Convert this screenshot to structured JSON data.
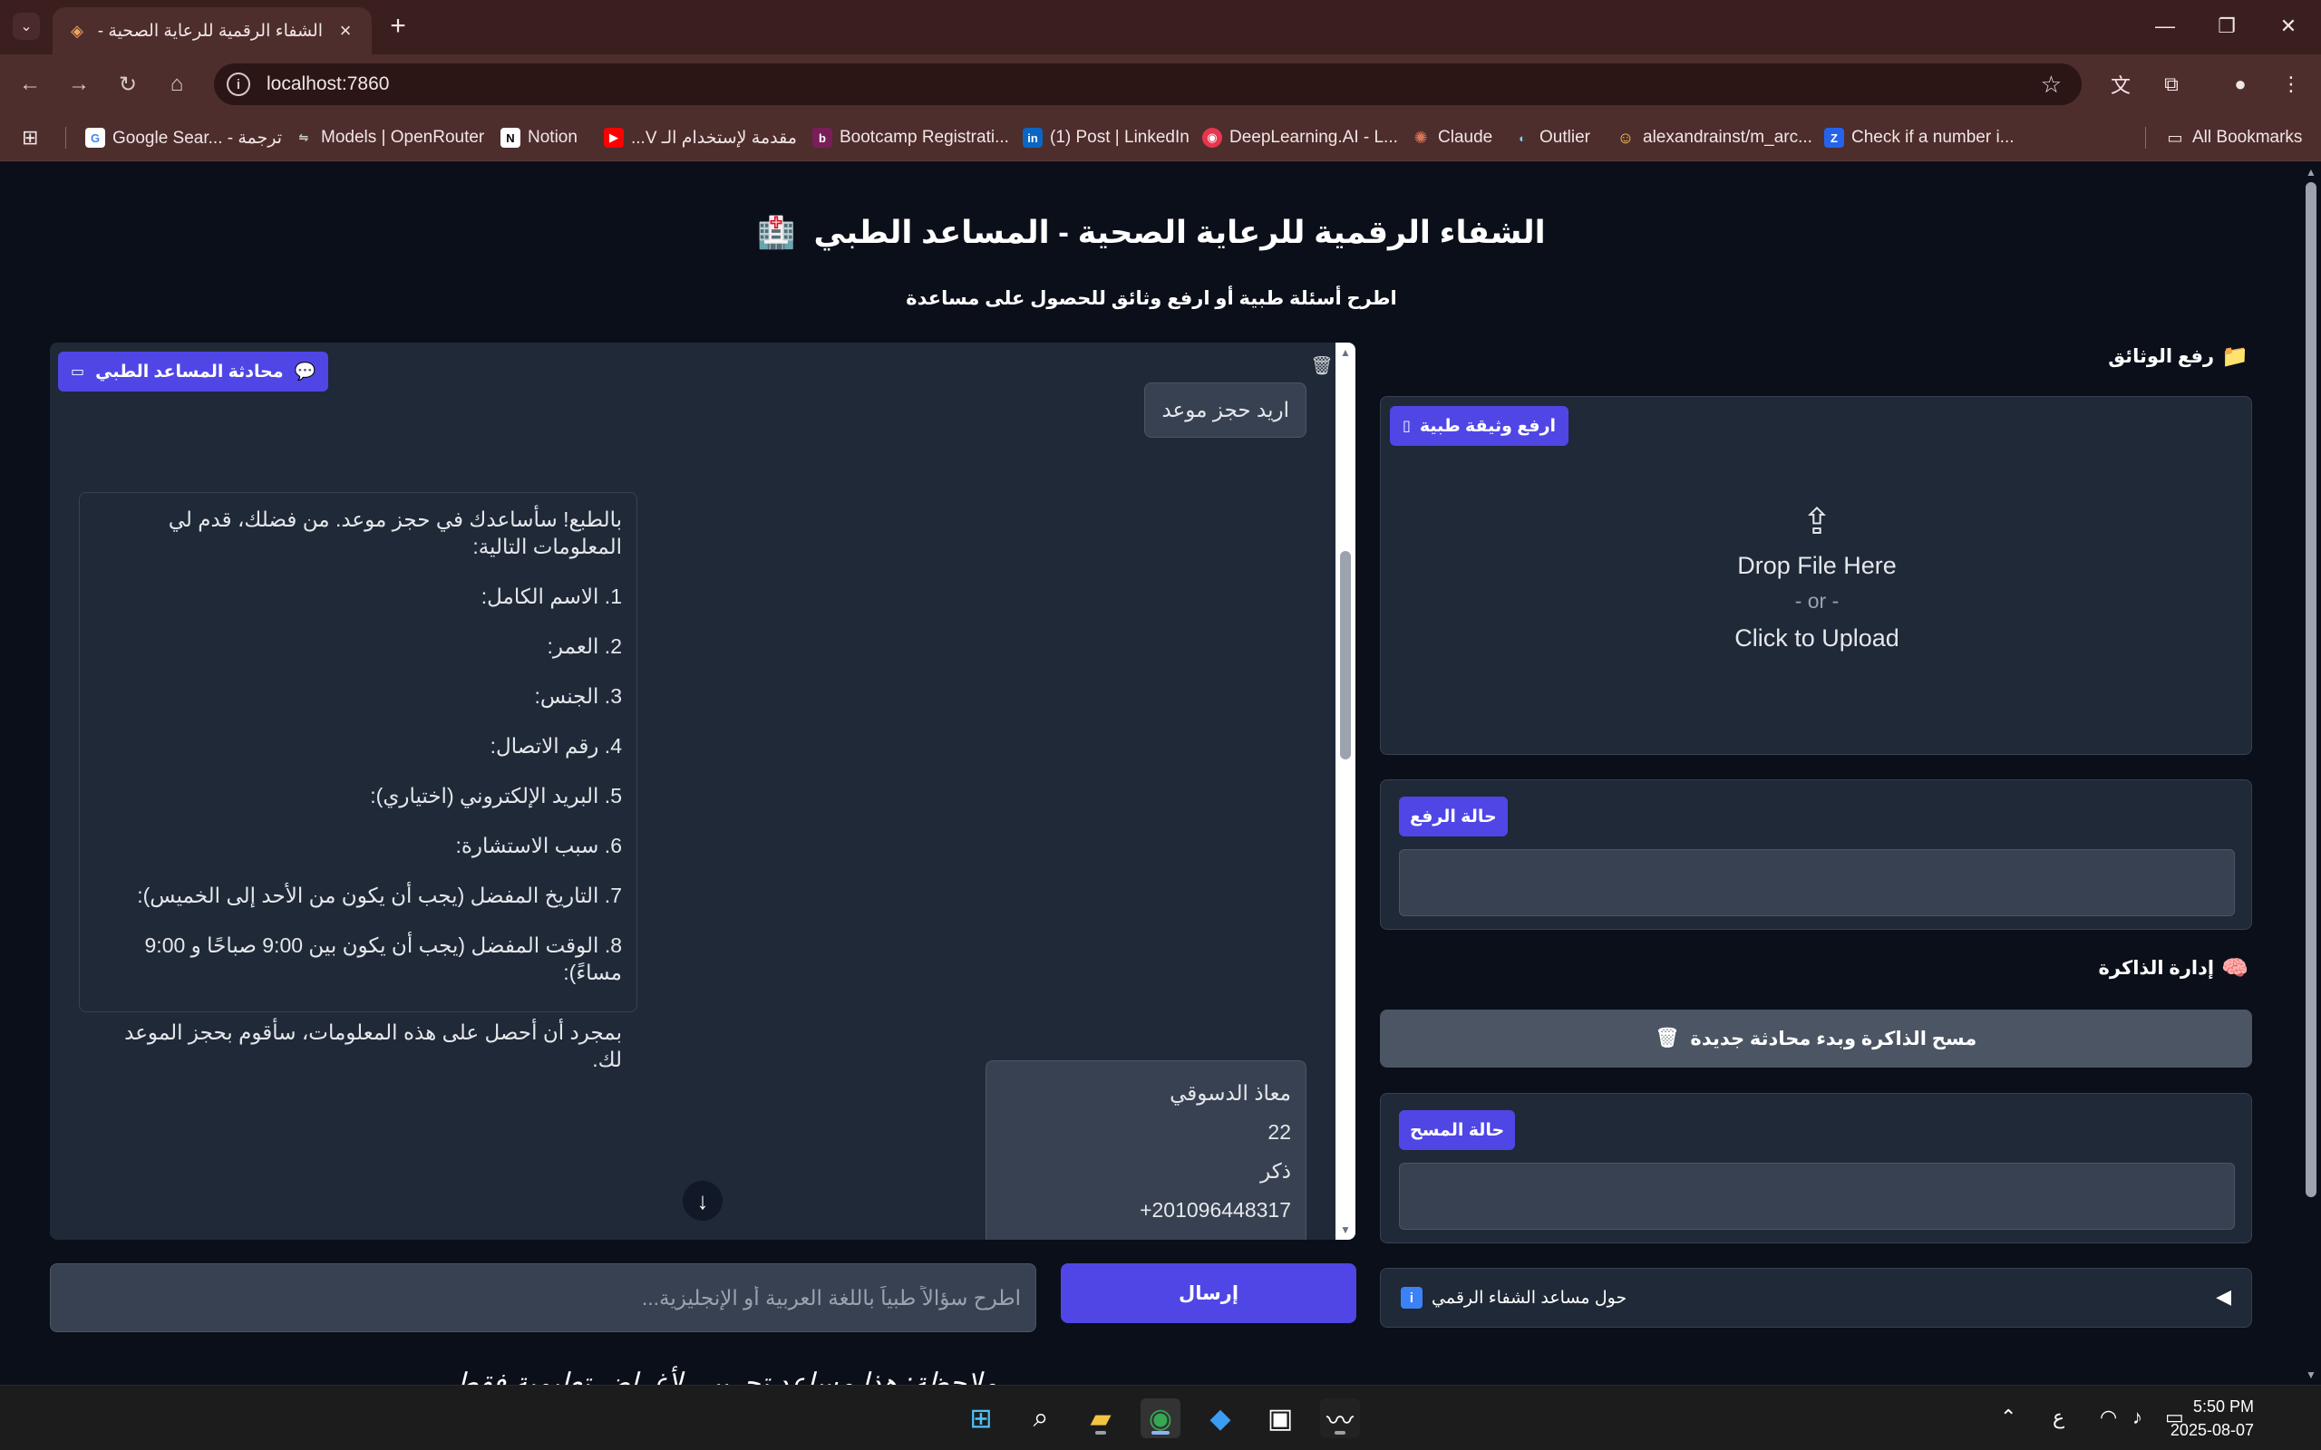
{
  "browser": {
    "tab_title": "الشفاء الرقمية للرعاية الصحية - الـ",
    "url": "localhost:7860",
    "bookmarks": [
      {
        "label": "Google Sear... - ترجمة",
        "icon": "google-icon"
      },
      {
        "label": "Models | OpenRouter",
        "icon": "openrouter-icon"
      },
      {
        "label": "Notion",
        "icon": "notion-icon"
      },
      {
        "label": "مقدمة لإستخدام الـ V...",
        "icon": "youtube-icon"
      },
      {
        "label": "Bootcamp Registrati...",
        "icon": "bootcamp-icon"
      },
      {
        "label": "(1) Post | LinkedIn",
        "icon": "linkedin-icon"
      },
      {
        "label": "DeepLearning.AI - L...",
        "icon": "deeplearning-icon"
      },
      {
        "label": "Claude",
        "icon": "claude-icon"
      },
      {
        "label": "Outlier",
        "icon": "outlier-icon"
      },
      {
        "label": "alexandrainst/m_arc...",
        "icon": "huggingface-icon"
      },
      {
        "label": "Check if a number i...",
        "icon": "check-icon"
      }
    ],
    "all_bookmarks": "All Bookmarks"
  },
  "page": {
    "title": "الشفاء الرقمية للرعاية الصحية - المساعد الطبي",
    "subtitle": "اطرح أسئلة طبية أو ارفع وثائق للحصول على مساعدة"
  },
  "chat": {
    "label": "محادثة المساعد الطبي",
    "user_msg_1": "اريد حجز موعد",
    "bot_msg": {
      "intro": "بالطبع! سأساعدك في حجز موعد. من فضلك، قدم لي المعلومات التالية:",
      "items": [
        "1. الاسم الكامل:",
        "2. العمر:",
        "3. الجنس:",
        "4. رقم الاتصال:",
        "5. البريد الإلكتروني (اختياري):",
        "6. سبب الاستشارة:",
        "7. التاريخ المفضل (يجب أن يكون من الأحد إلى الخميس):",
        "8. الوقت المفضل (يجب أن يكون بين 9:00 صباحًا و 9:00 مساءً):"
      ],
      "outro": "بمجرد أن أحصل على هذه المعلومات، سأقوم بحجز الموعد لك."
    },
    "user_msg_2": [
      "معاذ الدسوقي",
      "22",
      "ذكر",
      "+201096448317"
    ],
    "input_placeholder": "اطرح سؤالاً طبياً باللغة العربية أو الإنجليزية...",
    "send_label": "إرسال"
  },
  "sidebar": {
    "upload_heading": "رفع الوثائق",
    "upload_label": "ارفع وثيقة طبية",
    "drop_text": "Drop File Here",
    "or_text": "- or -",
    "click_text": "Click to Upload",
    "upload_status_label": "حالة الرفع",
    "memory_heading": "إدارة الذاكرة",
    "clear_memory_label": "مسح الذاكرة وبدء محادثة جديدة",
    "clear_status_label": "حالة المسح",
    "about_label": "حول مساعد الشفاء الرقمي"
  },
  "footer": {
    "text": "ملاحظة: هذا مساعد تجريبي لأغراض تعليمية فقط"
  },
  "taskbar": {
    "lang": "ع",
    "time": "5:50 PM",
    "date": "2025-08-07"
  },
  "colors": {
    "accent": "#4f46e5",
    "panel": "#1f2937",
    "page_bg": "#0b0f19",
    "browser_chrome": "#4e2d2d"
  }
}
